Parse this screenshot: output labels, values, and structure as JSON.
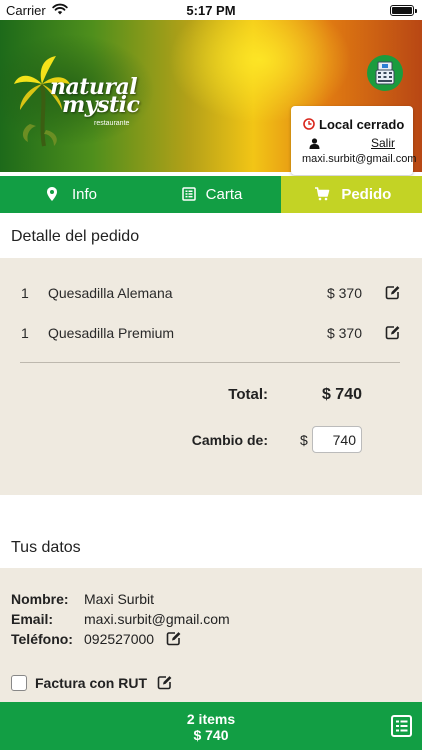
{
  "status_bar": {
    "carrier": "Carrier",
    "time": "5:17 PM"
  },
  "header": {
    "logo": {
      "line1": "natural",
      "line2": "mystic",
      "line3": "restaurante"
    },
    "store_status": "Local cerrado",
    "logout_label": "Salir",
    "user_email": "maxi.surbit@gmail.com"
  },
  "tabs": [
    {
      "label": "Info",
      "icon": "location-pin-icon"
    },
    {
      "label": "Carta",
      "icon": "menu-list-icon"
    },
    {
      "label": "Pedido",
      "icon": "cart-icon",
      "active": true
    }
  ],
  "order": {
    "title": "Detalle del pedido",
    "items": [
      {
        "qty": "1",
        "name": "Quesadilla Alemana",
        "price": "$ 370"
      },
      {
        "qty": "1",
        "name": "Quesadilla Premium",
        "price": "$ 370"
      }
    ],
    "total_label": "Total:",
    "total_value": "$ 740",
    "change_label": "Cambio de:",
    "change_currency": "$",
    "change_value": "740"
  },
  "user_data": {
    "title": "Tus datos",
    "name_label": "Nombre:",
    "name_value": "Maxi Surbit",
    "email_label": "Email:",
    "email_value": "maxi.surbit@gmail.com",
    "phone_label": "Teléfono:",
    "phone_value": "092527000",
    "invoice_label": "Factura con RUT",
    "invoice_checked": false
  },
  "bottom_bar": {
    "items_count": "2 items",
    "total": "$ 740"
  },
  "colors": {
    "green": "#129e44",
    "active_tab": "#c3d325",
    "panel_bg": "#efeae0",
    "clock_red": "#d9261c"
  }
}
